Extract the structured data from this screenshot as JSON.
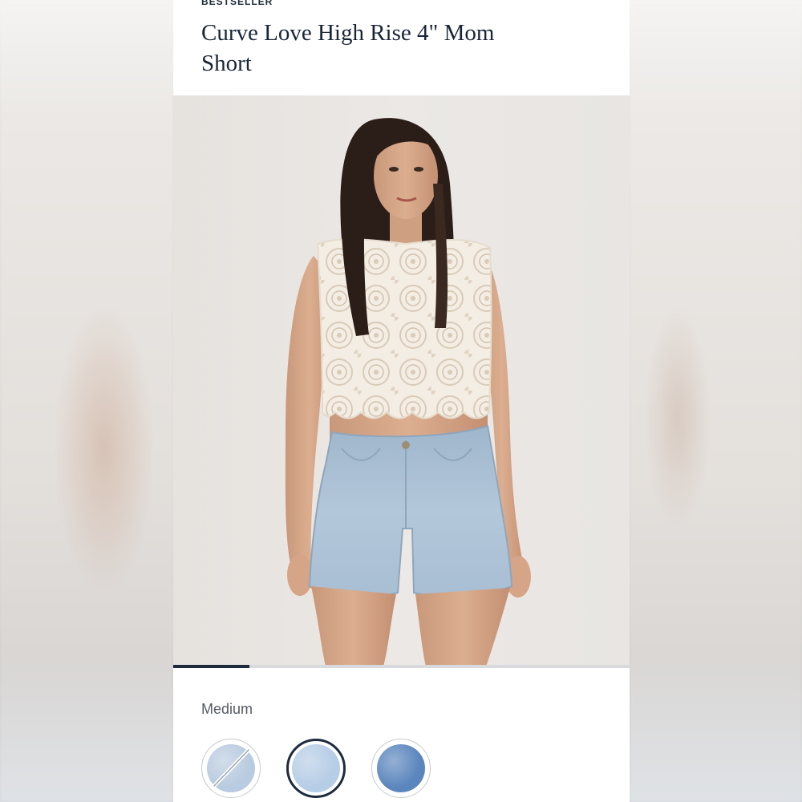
{
  "product": {
    "badge": "BESTSELLER",
    "title": "Curve Love High Rise 4\" Mom Short"
  },
  "gallery": {
    "image_alt": "Model wearing light wash denim mom shorts with a white crochet crop top",
    "progress_fraction": 0.167
  },
  "options": {
    "wash_label": "Medium",
    "swatches": [
      {
        "name": "Light wash",
        "color": "#b9cbe0",
        "unavailable": true,
        "selected": false
      },
      {
        "name": "Medium",
        "color": "#b6cde6",
        "unavailable": false,
        "selected": true
      },
      {
        "name": "Medium dark",
        "color": "#5b86bd",
        "unavailable": false,
        "selected": false
      }
    ]
  },
  "colors": {
    "text_primary": "#1a2638",
    "accent": "#1e2b3f"
  }
}
